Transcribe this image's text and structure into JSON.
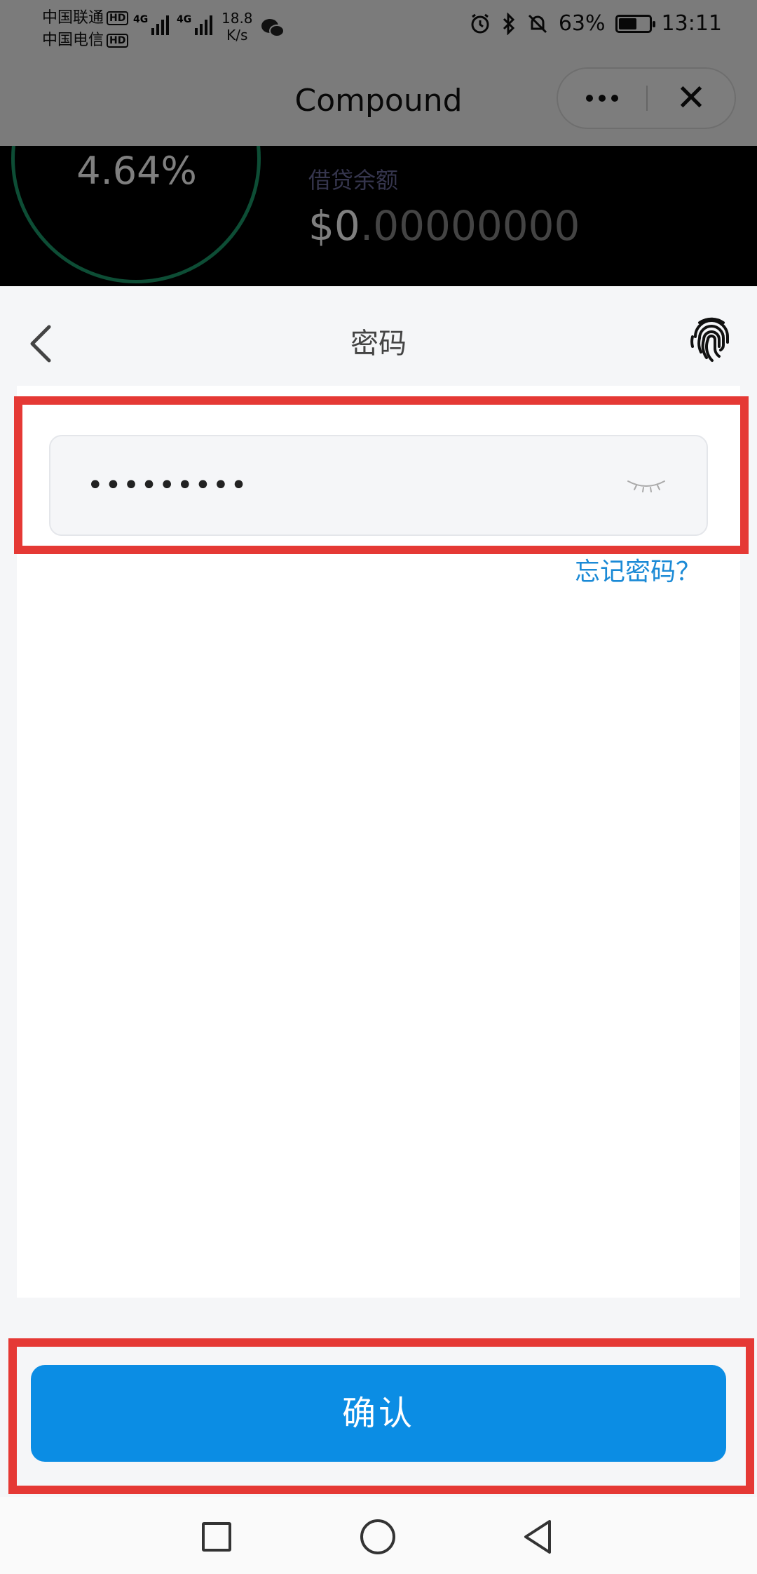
{
  "status_bar": {
    "carrier1": "中国联通",
    "carrier2": "中国电信",
    "hd": "HD",
    "network": "4G",
    "speed_value": "18.8",
    "speed_unit": "K/s",
    "battery": "63%",
    "battery_level": 0.63,
    "time": "13:11"
  },
  "header": {
    "title": "Compound",
    "more_icon": "more-dots-icon",
    "close_icon": "close-icon"
  },
  "background": {
    "rate": "4.64%",
    "borrow_label": "借贷余额",
    "borrow_value_main": "$0",
    "borrow_value_rest": ".00000000"
  },
  "sheet": {
    "title": "密码",
    "password_value": "•••••••••",
    "forgot_label": "忘记密码？",
    "confirm_label": "确认"
  },
  "colors": {
    "accent": "#0b8de4",
    "link": "#1b8ad6",
    "highlight": "#e53935"
  }
}
